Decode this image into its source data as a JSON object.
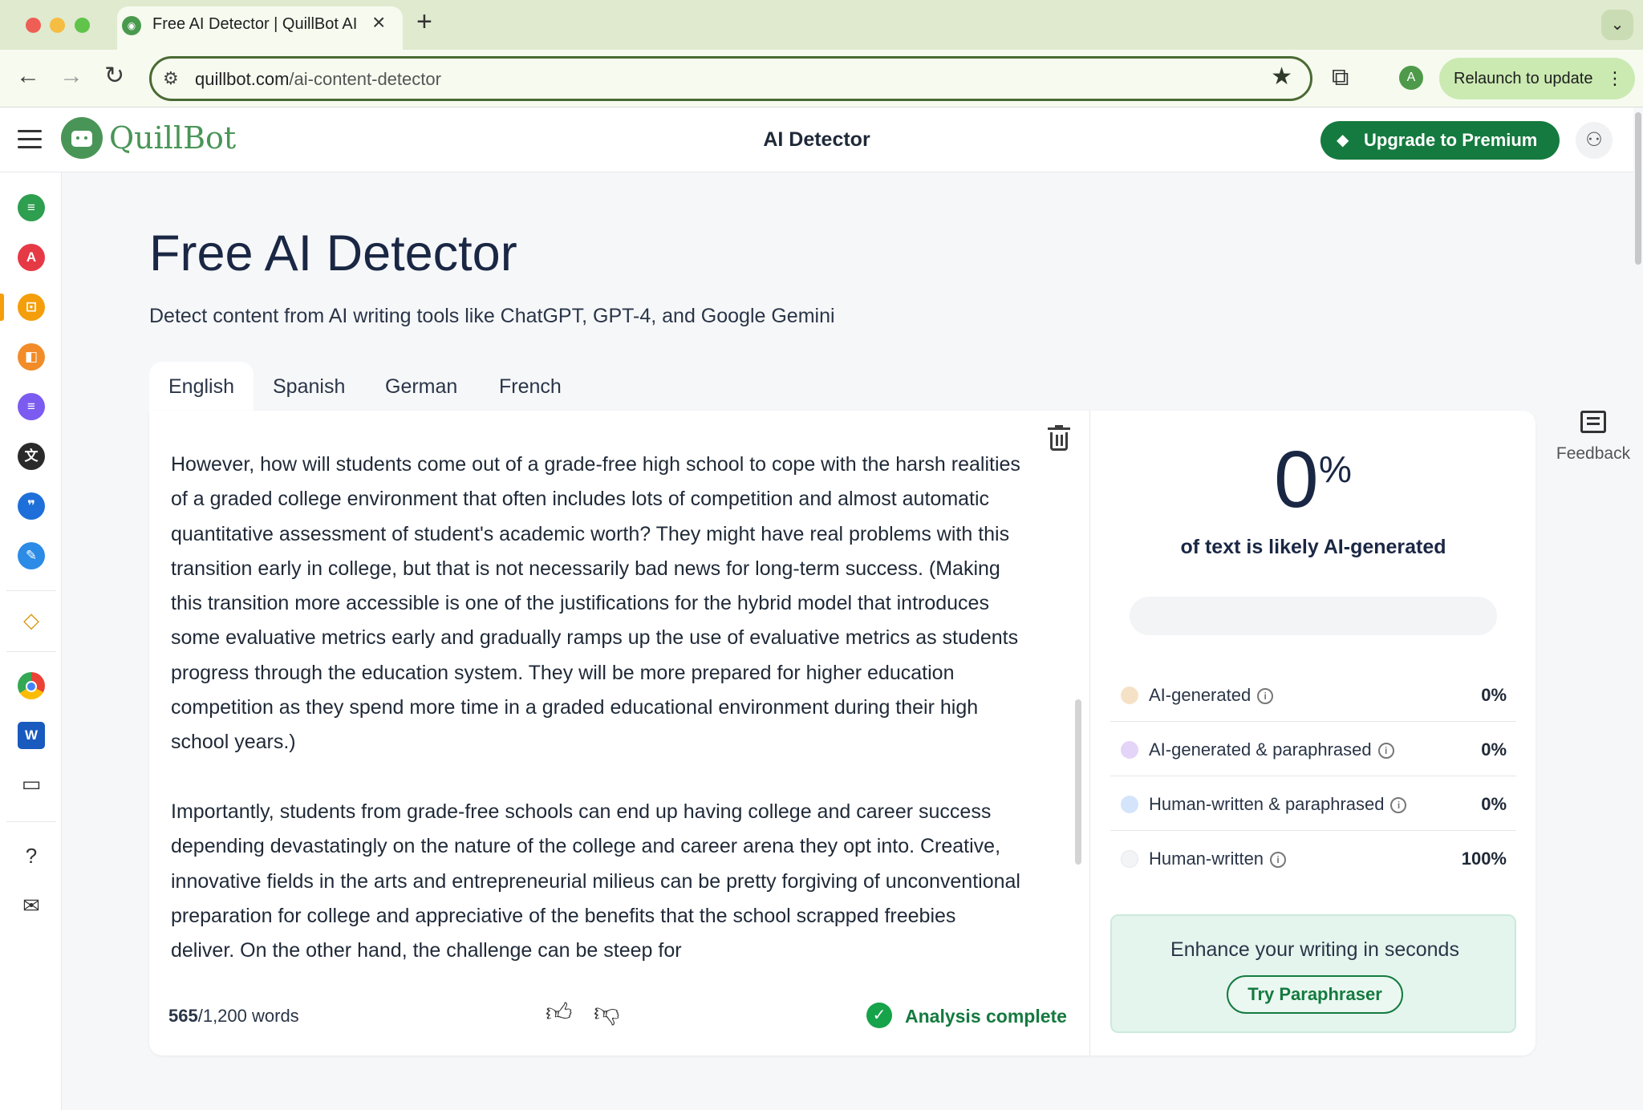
{
  "browser": {
    "tab_title": "Free AI Detector | QuillBot AI",
    "url_host": "quillbot.com",
    "url_path": "/ai-content-detector",
    "profile_initial": "A",
    "relaunch_label": "Relaunch to update"
  },
  "header": {
    "logo_text": "QuillBot",
    "title": "AI Detector",
    "premium_label": "Upgrade to Premium"
  },
  "page": {
    "heading": "Free AI Detector",
    "subheading": "Detect content from AI writing tools like ChatGPT, GPT-4, and Google Gemini",
    "tabs": [
      "English",
      "Spanish",
      "German",
      "French"
    ],
    "active_tab": "English"
  },
  "editor": {
    "paragraphs": [
      "However, how will students come out of a grade-free high school to cope with the harsh realities of a graded college environment that often includes lots of competition and almost automatic quantitative assessment of student's academic worth? They might have real problems with this transition early in college, but that is not necessarily bad news for long-term success. (Making this transition more accessible is one of the justifications for the hybrid model that introduces some evaluative metrics early and gradually ramps up the use of evaluative metrics as students progress through the education system. They will be more prepared for higher education competition as they spend more time in a graded educational environment during their high school years.)",
      "Importantly, students from grade-free schools can end up having college and career success depending devastatingly on the nature of the college and career arena they opt into. Creative, innovative fields in the arts and entrepreneurial milieus can be pretty forgiving of unconventional preparation for college and appreciative of the benefits that the school scrapped freebies deliver. On the other hand, the challenge can be steep for"
    ],
    "word_count": "565",
    "word_limit": "/1,200 words",
    "status": "Analysis complete"
  },
  "results": {
    "score": "0",
    "score_unit": "%",
    "caption": "of text is likely AI-generated",
    "ai_fraction": 0.0,
    "breakdown": [
      {
        "label": "AI-generated",
        "value": "0%",
        "color": "#f5e2c6"
      },
      {
        "label": "AI-generated & paraphrased",
        "value": "0%",
        "color": "#e4d4f7"
      },
      {
        "label": "Human-written & paraphrased",
        "value": "0%",
        "color": "#d3e4fb"
      },
      {
        "label": "Human-written",
        "value": "100%",
        "color": "#f3f4f6"
      }
    ],
    "enhance_title": "Enhance your writing in seconds",
    "enhance_button": "Try Paraphraser"
  },
  "feedback_label": "Feedback",
  "colors": {
    "brand_green": "#499557",
    "premium_green": "#157a3f",
    "heading_navy": "#1a2744"
  },
  "rail_icons": [
    {
      "name": "paraphraser-icon",
      "color": "#2e9e4f"
    },
    {
      "name": "grammar-checker-icon",
      "color": "#e63946"
    },
    {
      "name": "ai-detector-icon",
      "color": "#f59e0b"
    },
    {
      "name": "plagiarism-checker-icon",
      "color": "#f28c28"
    },
    {
      "name": "summarizer-icon",
      "color": "#7c5cf0"
    },
    {
      "name": "translator-icon",
      "color": "#2a2a2a"
    },
    {
      "name": "citation-generator-icon",
      "color": "#1e6fd9"
    },
    {
      "name": "quillbot-flow-icon",
      "color": "#2b8be6"
    }
  ]
}
